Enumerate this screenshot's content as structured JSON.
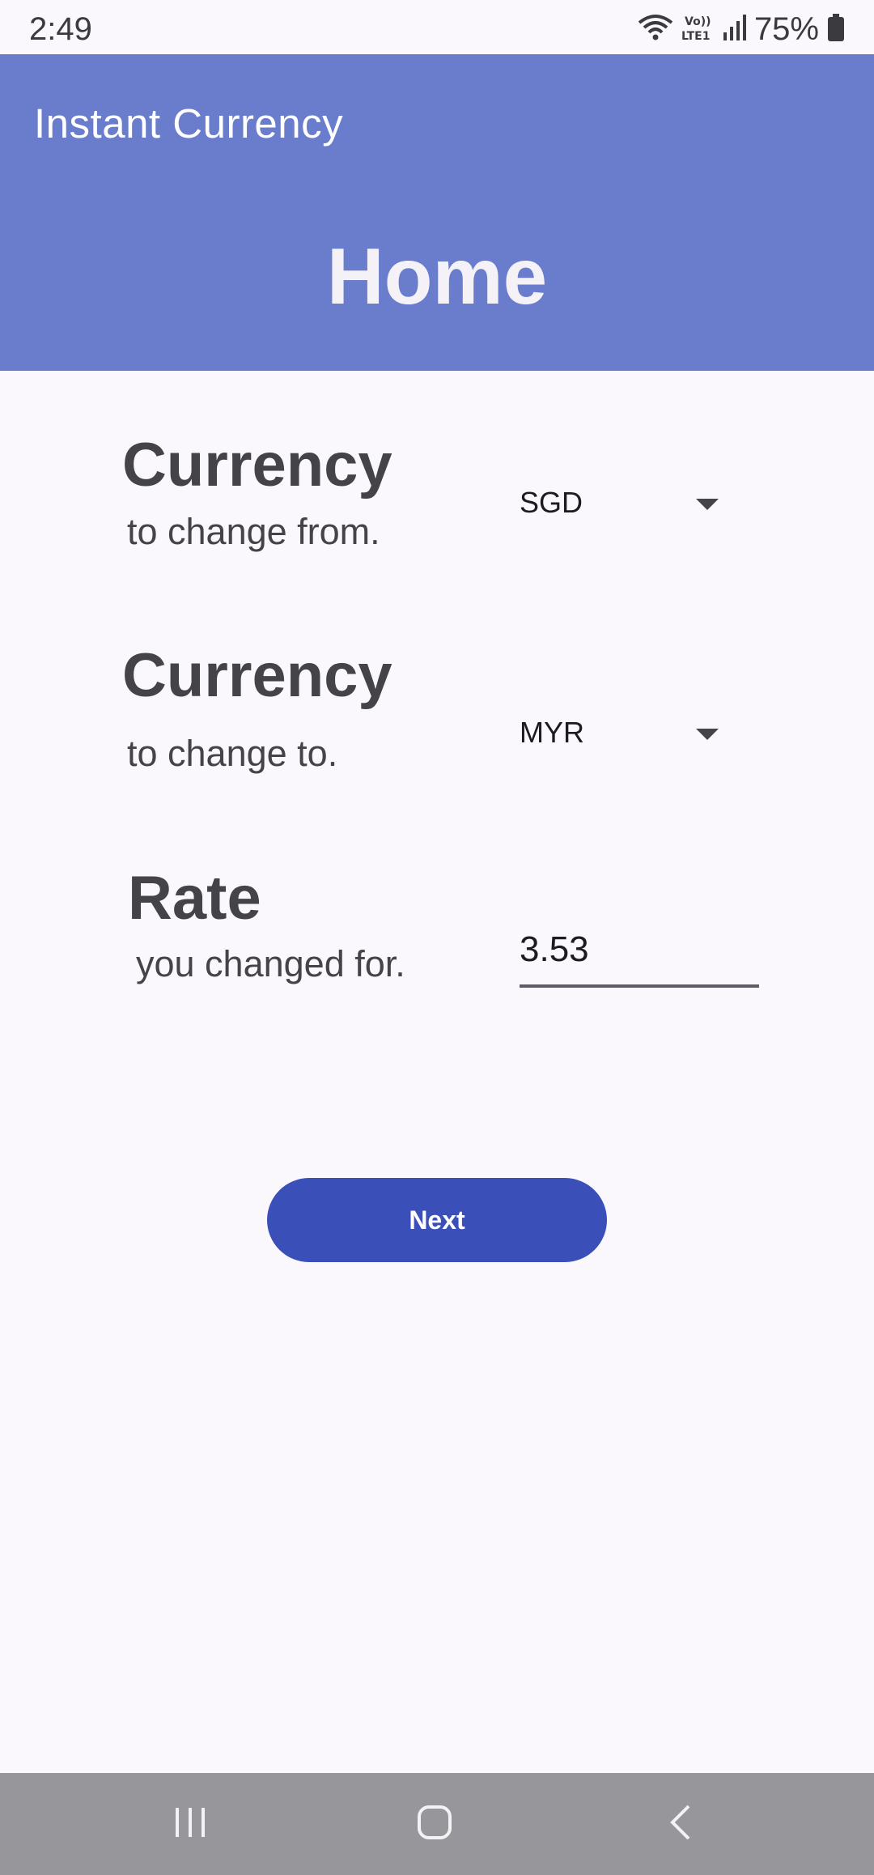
{
  "status_bar": {
    "time": "2:49",
    "battery": "75%",
    "icons": [
      "wifi-icon",
      "volte-icon",
      "signal-icon",
      "battery-icon"
    ]
  },
  "app_bar": {
    "app_title": "Instant Currency",
    "page_title": "Home",
    "background_color": "#6a7ccc"
  },
  "form": {
    "from": {
      "heading": "Currency",
      "subtext": "to change from.",
      "selected": "SGD"
    },
    "to": {
      "heading": "Currency",
      "subtext": "to change to.",
      "selected": "MYR"
    },
    "rate": {
      "heading": "Rate",
      "subtext": "you changed for.",
      "value": "3.53"
    }
  },
  "next_button": {
    "label": "Next",
    "color": "#3a4fb8"
  },
  "nav_bar": {
    "icons": [
      "recent-apps-icon",
      "home-icon",
      "back-icon"
    ]
  }
}
